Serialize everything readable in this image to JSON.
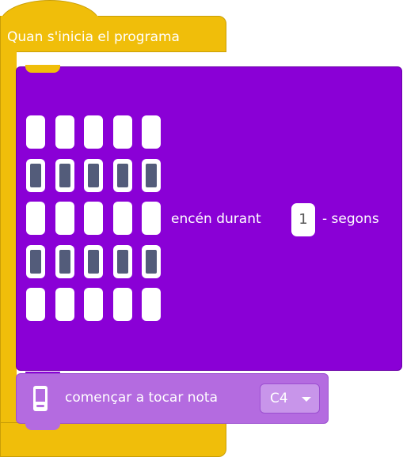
{
  "hat_block": {
    "title": "Quan s'inicia el programa",
    "color": "#f0be0a"
  },
  "show_leds_block": {
    "color": "#8a00d6",
    "led_matrix": [
      [
        1,
        1,
        1,
        1,
        1
      ],
      [
        0,
        0,
        0,
        0,
        0
      ],
      [
        1,
        1,
        1,
        1,
        1
      ],
      [
        0,
        0,
        0,
        0,
        0
      ],
      [
        1,
        1,
        1,
        1,
        1
      ]
    ],
    "label_before": "encén durant",
    "duration": "1",
    "label_after": "- segons"
  },
  "play_note_block": {
    "color": "#b46be0",
    "icon": "microbit-chip-icon",
    "label": "començar a tocar nota",
    "note": "C4",
    "dropdown_icon": "caret-down-icon"
  }
}
